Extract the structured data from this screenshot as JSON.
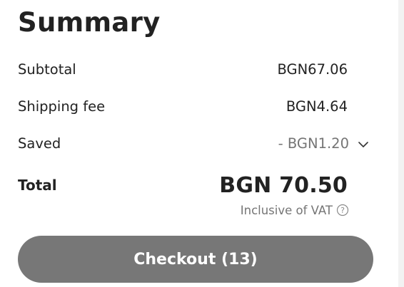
{
  "summary": {
    "title": "Summary",
    "subtotal": {
      "label": "Subtotal",
      "value": "BGN67.06"
    },
    "shipping": {
      "label": "Shipping fee",
      "value": "BGN4.64"
    },
    "saved": {
      "label": "Saved",
      "value": "- BGN1.20",
      "expand_icon": "chevron-down-icon"
    },
    "total": {
      "label": "Total",
      "value": "BGN 70.50"
    },
    "vat_note": "Inclusive of VAT",
    "vat_icon": "question-circle-icon",
    "checkout_label": "Checkout (13)"
  },
  "colors": {
    "text_primary": "#222222",
    "text_secondary": "#757575",
    "checkout_bg": "#777777",
    "checkout_text": "#ffffff"
  }
}
